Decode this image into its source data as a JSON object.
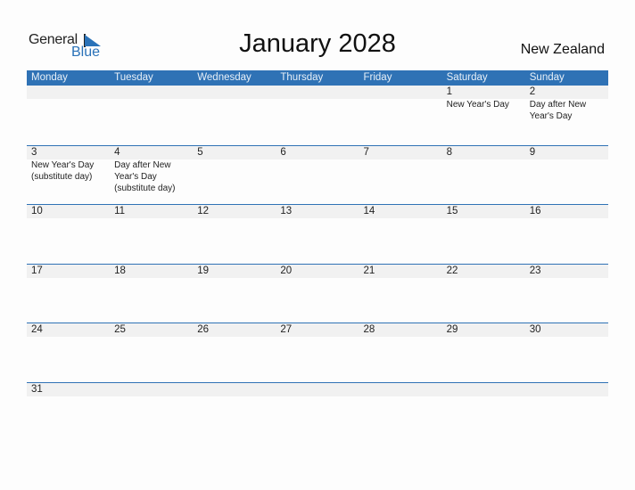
{
  "logo": {
    "line1": "General",
    "line2": "Blue"
  },
  "title": "January 2028",
  "country": "New Zealand",
  "colors": {
    "header_bg": "#2f72b5",
    "accent": "#2a72b8",
    "date_strip": "#f1f1f1"
  },
  "weekdays": [
    "Monday",
    "Tuesday",
    "Wednesday",
    "Thursday",
    "Friday",
    "Saturday",
    "Sunday"
  ],
  "weeks": [
    [
      {
        "day": "",
        "holiday": ""
      },
      {
        "day": "",
        "holiday": ""
      },
      {
        "day": "",
        "holiday": ""
      },
      {
        "day": "",
        "holiday": ""
      },
      {
        "day": "",
        "holiday": ""
      },
      {
        "day": "1",
        "holiday": "New Year's Day"
      },
      {
        "day": "2",
        "holiday": "Day after New Year's Day"
      }
    ],
    [
      {
        "day": "3",
        "holiday": "New Year's Day (substitute day)"
      },
      {
        "day": "4",
        "holiday": "Day after New Year's Day (substitute day)"
      },
      {
        "day": "5",
        "holiday": ""
      },
      {
        "day": "6",
        "holiday": ""
      },
      {
        "day": "7",
        "holiday": ""
      },
      {
        "day": "8",
        "holiday": ""
      },
      {
        "day": "9",
        "holiday": ""
      }
    ],
    [
      {
        "day": "10",
        "holiday": ""
      },
      {
        "day": "11",
        "holiday": ""
      },
      {
        "day": "12",
        "holiday": ""
      },
      {
        "day": "13",
        "holiday": ""
      },
      {
        "day": "14",
        "holiday": ""
      },
      {
        "day": "15",
        "holiday": ""
      },
      {
        "day": "16",
        "holiday": ""
      }
    ],
    [
      {
        "day": "17",
        "holiday": ""
      },
      {
        "day": "18",
        "holiday": ""
      },
      {
        "day": "19",
        "holiday": ""
      },
      {
        "day": "20",
        "holiday": ""
      },
      {
        "day": "21",
        "holiday": ""
      },
      {
        "day": "22",
        "holiday": ""
      },
      {
        "day": "23",
        "holiday": ""
      }
    ],
    [
      {
        "day": "24",
        "holiday": ""
      },
      {
        "day": "25",
        "holiday": ""
      },
      {
        "day": "26",
        "holiday": ""
      },
      {
        "day": "27",
        "holiday": ""
      },
      {
        "day": "28",
        "holiday": ""
      },
      {
        "day": "29",
        "holiday": ""
      },
      {
        "day": "30",
        "holiday": ""
      }
    ],
    [
      {
        "day": "31",
        "holiday": ""
      },
      {
        "day": "",
        "holiday": ""
      },
      {
        "day": "",
        "holiday": ""
      },
      {
        "day": "",
        "holiday": ""
      },
      {
        "day": "",
        "holiday": ""
      },
      {
        "day": "",
        "holiday": ""
      },
      {
        "day": "",
        "holiday": ""
      }
    ]
  ]
}
